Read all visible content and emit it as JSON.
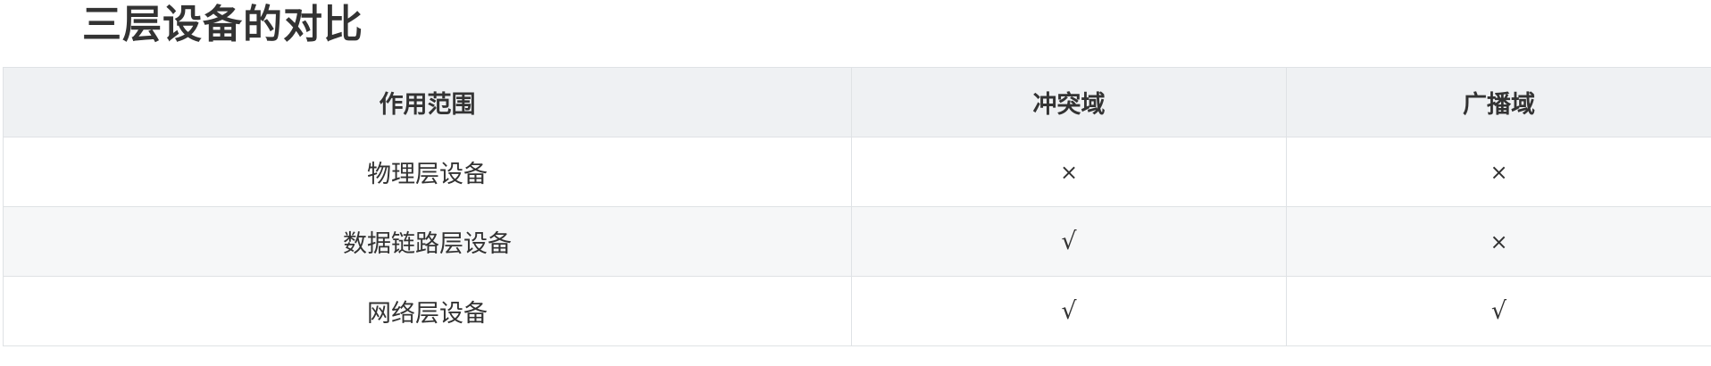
{
  "title": "三层设备的对比",
  "table": {
    "headers": [
      "作用范围",
      "冲突域",
      "广播域"
    ],
    "rows": [
      [
        "物理层设备",
        "×",
        "×"
      ],
      [
        "数据链路层设备",
        "√",
        "×"
      ],
      [
        "网络层设备",
        "√",
        "√"
      ]
    ]
  }
}
